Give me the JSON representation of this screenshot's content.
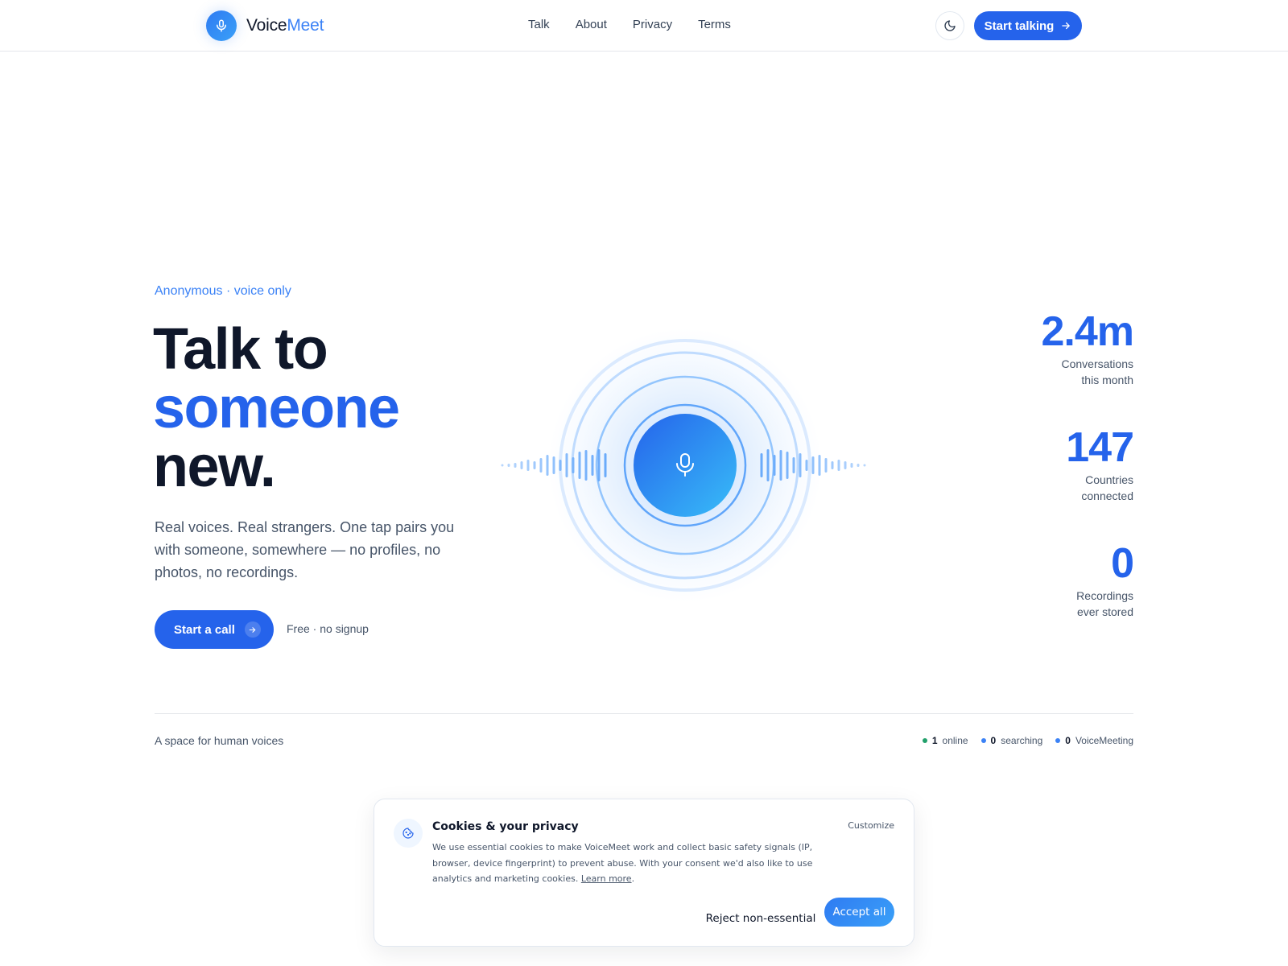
{
  "header": {
    "brand_prefix": "Voice",
    "brand_accent": "Meet",
    "nav": [
      "Talk",
      "About",
      "Privacy",
      "Terms"
    ],
    "cta": "Start talking"
  },
  "hero": {
    "eyebrow": "Anonymous · voice only",
    "headline_line1": "Talk to",
    "headline_line2": "someone",
    "headline_line3": "new.",
    "lede": "Real voices. Real strangers. One tap pairs you with someone, somewhere — no profiles, no photos, no recordings.",
    "start_button": "Start a call",
    "free_note": "Free · no signup"
  },
  "stats": [
    {
      "value": "2.4m",
      "label_line1": "Conversations",
      "label_line2": "this month"
    },
    {
      "value": "147",
      "label_line1": "Countries",
      "label_line2": "connected"
    },
    {
      "value": "0",
      "label_line1": "Recordings",
      "label_line2": "ever stored"
    }
  ],
  "footer_strip": {
    "tagline": "A space for human voices",
    "presence": [
      {
        "count": "1",
        "label": "online",
        "color": "#22a06b"
      },
      {
        "count": "0",
        "label": "searching",
        "color": "#3b82f6"
      },
      {
        "count": "0",
        "label": "VoiceMeeting",
        "color": "#3b82f6"
      }
    ]
  },
  "cookie": {
    "title": "Cookies & your privacy",
    "customize": "Customize",
    "text": "We use essential cookies to make VoiceMeet work and collect basic safety signals (IP, browser, device fingerprint) to prevent abuse. With your consent we'd also like to use analytics and marketing cookies.",
    "learn_more": "Learn more",
    "reject": "Reject non-essential",
    "accept": "Accept all"
  },
  "colors": {
    "primary": "#2563eb",
    "accent": "#3b82f6",
    "online": "#22a06b"
  }
}
